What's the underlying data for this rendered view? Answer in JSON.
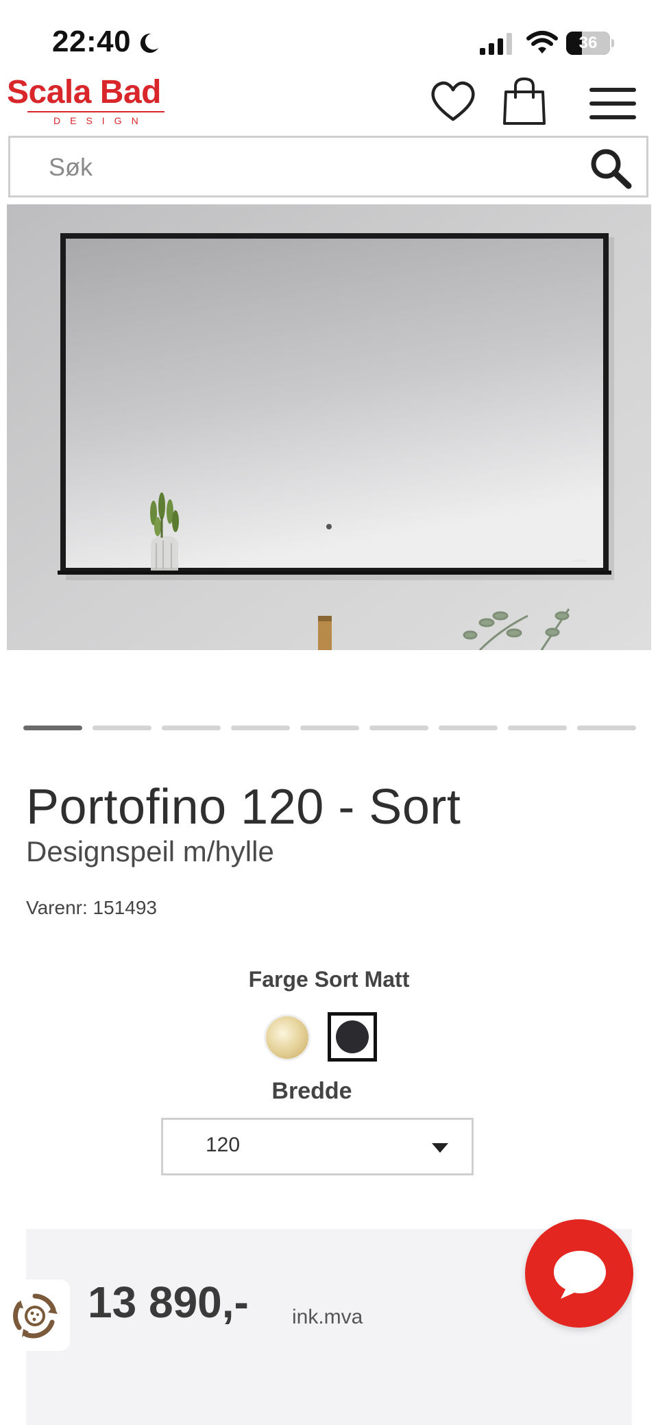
{
  "status_bar": {
    "time": "22:40",
    "battery": "36",
    "battery_level": 0.36
  },
  "header": {
    "logo_main": "Scala Bad",
    "logo_sub": "DESIGN"
  },
  "search": {
    "placeholder": "Søk"
  },
  "gallery": {
    "image_count": 9,
    "active_index": 0
  },
  "product": {
    "title": "Portofino 120 - Sort",
    "subtitle": "Designspeil m/hylle",
    "sku_label": "Varenr:",
    "sku": "151493"
  },
  "options": {
    "color_label": "Farge",
    "color_value": "Sort Matt",
    "colors": [
      {
        "name": "gold",
        "hex": "#d8c081",
        "selected": false
      },
      {
        "name": "black",
        "hex": "#2a2a2f",
        "selected": true
      }
    ],
    "width_label": "Bredde",
    "width_value": "120"
  },
  "price": {
    "amount": "13 890,-",
    "vat_note": "ink.mva"
  },
  "colors": {
    "brand": "#d8262b",
    "chat": "#e3261f"
  }
}
